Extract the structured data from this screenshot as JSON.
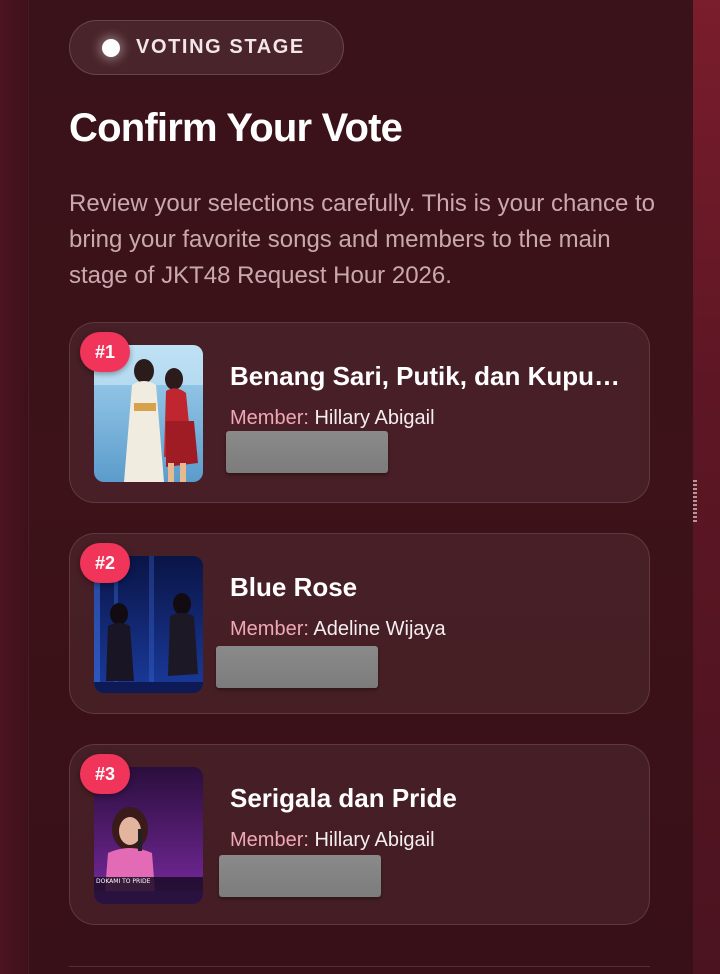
{
  "header": {
    "stage_label": "VOTING STAGE",
    "title": "Confirm Your Vote",
    "description": "Review your selections carefully. This is your chance to bring your favorite songs and members to the main stage of JKT48 Request Hour 2026."
  },
  "votes": [
    {
      "rank": "#1",
      "song": "Benang Sari, Putik, dan Kupu-kupu",
      "member_label": "Member:",
      "member": "Hillary Abigail"
    },
    {
      "rank": "#2",
      "song": "Blue Rose",
      "member_label": "Member:",
      "member": "Adeline Wijaya"
    },
    {
      "rank": "#3",
      "song": "Serigala dan Pride",
      "member_label": "Member:",
      "member": "Hillary Abigail",
      "thumb_caption": "DOKAMI TO PRIDE"
    }
  ],
  "colors": {
    "accent": "#f0345a",
    "member_label": "#f0a8b5",
    "background": "#3a1219"
  }
}
